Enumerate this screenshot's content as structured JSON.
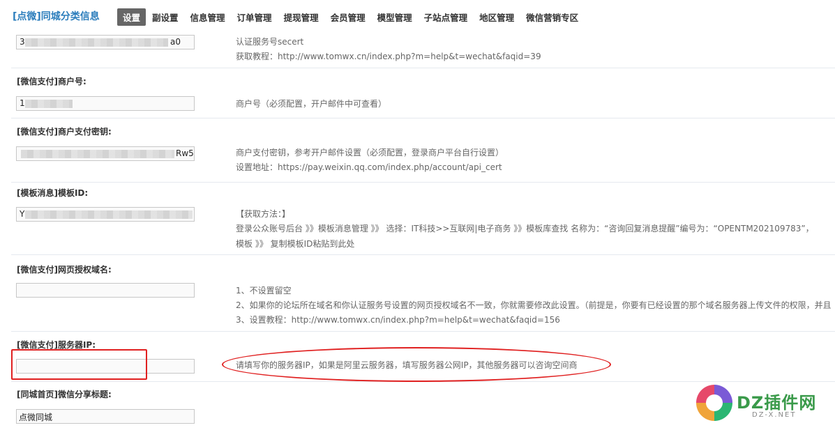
{
  "header": {
    "brand": "[点微]同城分类信息",
    "nav": [
      {
        "label": "设置",
        "active": true
      },
      {
        "label": "副设置"
      },
      {
        "label": "信息管理"
      },
      {
        "label": "订单管理"
      },
      {
        "label": "提现管理"
      },
      {
        "label": "会员管理"
      },
      {
        "label": "模型管理"
      },
      {
        "label": "子站点管理"
      },
      {
        "label": "地区管理"
      },
      {
        "label": "微信营销专区"
      }
    ]
  },
  "rows": {
    "secret": {
      "value_start": "3",
      "value_end": "a0",
      "help": [
        "认证服务号secert",
        "获取教程：http://www.tomwx.cn/index.php?m=help&t=wechat&faqid=39"
      ]
    },
    "mchid": {
      "label": "[微信支付]商户号:",
      "value_start": "1",
      "help": [
        "商户号（必须配置，开户邮件中可查看）"
      ]
    },
    "paykey": {
      "label": "[微信支付]商户支付密钥:",
      "value_end": "Rw5",
      "help": [
        "商户支付密钥，参考开户邮件设置（必须配置，登录商户平台自行设置）",
        "设置地址：https://pay.weixin.qq.com/index.php/account/api_cert"
      ]
    },
    "template": {
      "label": "[模板消息]模板ID:",
      "value_start": "Y",
      "help": [
        "【获取方法：】",
        "登录公众账号后台 》》模板消息管理 》》 选择：IT科技>>互联网|电子商务 》》模板库查找 名称为：“咨询回复消息提醒”编号为：“OPENTM202109783”，",
        "模板 》》 复制模板ID粘贴到此处"
      ]
    },
    "oauth": {
      "label": "[微信支付]网页授权域名:",
      "help": [
        "1、不设置留空",
        "2、如果你的论坛所在域名和你认证服务号设置的网页授权域名不一致，你就需要修改此设置。（前提是，你要有已经设置的那个域名服务器上传文件的权限，并且",
        "3、设置教程：http://www.tomwx.cn/index.php?m=help&t=wechat&faqid=156"
      ]
    },
    "serverip": {
      "label": "[微信支付]服务器IP:",
      "help": [
        "请填写你的服务器IP，如果是阿里云服务器，填写服务器公网IP，其他服务器可以咨询空间商"
      ]
    },
    "share": {
      "label": "[同城首页]微信分享标题:",
      "value": "点微同城"
    }
  },
  "watermark": {
    "text": "DZ插件网",
    "sub": "DZ-X.NET"
  }
}
